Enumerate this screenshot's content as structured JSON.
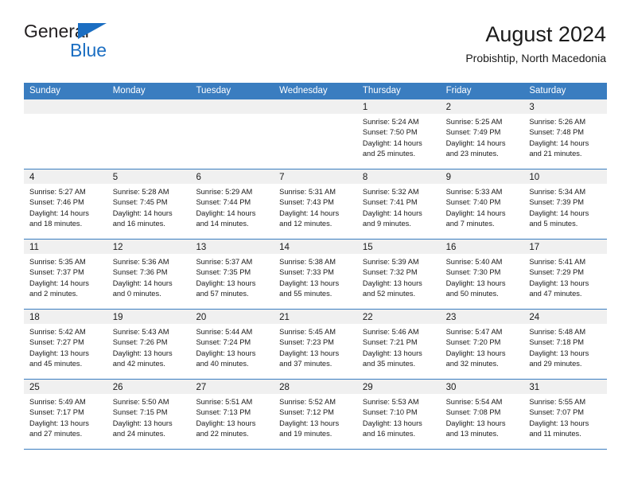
{
  "brand": {
    "name_part1": "General",
    "name_part2": "Blue",
    "triangle_color": "#1b6ec2"
  },
  "header": {
    "title": "August 2024",
    "subtitle": "Probishtip, North Macedonia"
  },
  "theme": {
    "header_bg": "#3a7dc0",
    "header_text": "#ffffff",
    "daynum_bg": "#f0f0f0",
    "grid_line": "#3a7dc0"
  },
  "weekdays": [
    "Sunday",
    "Monday",
    "Tuesday",
    "Wednesday",
    "Thursday",
    "Friday",
    "Saturday"
  ],
  "weeks": [
    [
      {
        "day": "",
        "sunrise": "",
        "sunset": "",
        "daylight1": "",
        "daylight2": ""
      },
      {
        "day": "",
        "sunrise": "",
        "sunset": "",
        "daylight1": "",
        "daylight2": ""
      },
      {
        "day": "",
        "sunrise": "",
        "sunset": "",
        "daylight1": "",
        "daylight2": ""
      },
      {
        "day": "",
        "sunrise": "",
        "sunset": "",
        "daylight1": "",
        "daylight2": ""
      },
      {
        "day": "1",
        "sunrise": "Sunrise: 5:24 AM",
        "sunset": "Sunset: 7:50 PM",
        "daylight1": "Daylight: 14 hours",
        "daylight2": "and 25 minutes."
      },
      {
        "day": "2",
        "sunrise": "Sunrise: 5:25 AM",
        "sunset": "Sunset: 7:49 PM",
        "daylight1": "Daylight: 14 hours",
        "daylight2": "and 23 minutes."
      },
      {
        "day": "3",
        "sunrise": "Sunrise: 5:26 AM",
        "sunset": "Sunset: 7:48 PM",
        "daylight1": "Daylight: 14 hours",
        "daylight2": "and 21 minutes."
      }
    ],
    [
      {
        "day": "4",
        "sunrise": "Sunrise: 5:27 AM",
        "sunset": "Sunset: 7:46 PM",
        "daylight1": "Daylight: 14 hours",
        "daylight2": "and 18 minutes."
      },
      {
        "day": "5",
        "sunrise": "Sunrise: 5:28 AM",
        "sunset": "Sunset: 7:45 PM",
        "daylight1": "Daylight: 14 hours",
        "daylight2": "and 16 minutes."
      },
      {
        "day": "6",
        "sunrise": "Sunrise: 5:29 AM",
        "sunset": "Sunset: 7:44 PM",
        "daylight1": "Daylight: 14 hours",
        "daylight2": "and 14 minutes."
      },
      {
        "day": "7",
        "sunrise": "Sunrise: 5:31 AM",
        "sunset": "Sunset: 7:43 PM",
        "daylight1": "Daylight: 14 hours",
        "daylight2": "and 12 minutes."
      },
      {
        "day": "8",
        "sunrise": "Sunrise: 5:32 AM",
        "sunset": "Sunset: 7:41 PM",
        "daylight1": "Daylight: 14 hours",
        "daylight2": "and 9 minutes."
      },
      {
        "day": "9",
        "sunrise": "Sunrise: 5:33 AM",
        "sunset": "Sunset: 7:40 PM",
        "daylight1": "Daylight: 14 hours",
        "daylight2": "and 7 minutes."
      },
      {
        "day": "10",
        "sunrise": "Sunrise: 5:34 AM",
        "sunset": "Sunset: 7:39 PM",
        "daylight1": "Daylight: 14 hours",
        "daylight2": "and 5 minutes."
      }
    ],
    [
      {
        "day": "11",
        "sunrise": "Sunrise: 5:35 AM",
        "sunset": "Sunset: 7:37 PM",
        "daylight1": "Daylight: 14 hours",
        "daylight2": "and 2 minutes."
      },
      {
        "day": "12",
        "sunrise": "Sunrise: 5:36 AM",
        "sunset": "Sunset: 7:36 PM",
        "daylight1": "Daylight: 14 hours",
        "daylight2": "and 0 minutes."
      },
      {
        "day": "13",
        "sunrise": "Sunrise: 5:37 AM",
        "sunset": "Sunset: 7:35 PM",
        "daylight1": "Daylight: 13 hours",
        "daylight2": "and 57 minutes."
      },
      {
        "day": "14",
        "sunrise": "Sunrise: 5:38 AM",
        "sunset": "Sunset: 7:33 PM",
        "daylight1": "Daylight: 13 hours",
        "daylight2": "and 55 minutes."
      },
      {
        "day": "15",
        "sunrise": "Sunrise: 5:39 AM",
        "sunset": "Sunset: 7:32 PM",
        "daylight1": "Daylight: 13 hours",
        "daylight2": "and 52 minutes."
      },
      {
        "day": "16",
        "sunrise": "Sunrise: 5:40 AM",
        "sunset": "Sunset: 7:30 PM",
        "daylight1": "Daylight: 13 hours",
        "daylight2": "and 50 minutes."
      },
      {
        "day": "17",
        "sunrise": "Sunrise: 5:41 AM",
        "sunset": "Sunset: 7:29 PM",
        "daylight1": "Daylight: 13 hours",
        "daylight2": "and 47 minutes."
      }
    ],
    [
      {
        "day": "18",
        "sunrise": "Sunrise: 5:42 AM",
        "sunset": "Sunset: 7:27 PM",
        "daylight1": "Daylight: 13 hours",
        "daylight2": "and 45 minutes."
      },
      {
        "day": "19",
        "sunrise": "Sunrise: 5:43 AM",
        "sunset": "Sunset: 7:26 PM",
        "daylight1": "Daylight: 13 hours",
        "daylight2": "and 42 minutes."
      },
      {
        "day": "20",
        "sunrise": "Sunrise: 5:44 AM",
        "sunset": "Sunset: 7:24 PM",
        "daylight1": "Daylight: 13 hours",
        "daylight2": "and 40 minutes."
      },
      {
        "day": "21",
        "sunrise": "Sunrise: 5:45 AM",
        "sunset": "Sunset: 7:23 PM",
        "daylight1": "Daylight: 13 hours",
        "daylight2": "and 37 minutes."
      },
      {
        "day": "22",
        "sunrise": "Sunrise: 5:46 AM",
        "sunset": "Sunset: 7:21 PM",
        "daylight1": "Daylight: 13 hours",
        "daylight2": "and 35 minutes."
      },
      {
        "day": "23",
        "sunrise": "Sunrise: 5:47 AM",
        "sunset": "Sunset: 7:20 PM",
        "daylight1": "Daylight: 13 hours",
        "daylight2": "and 32 minutes."
      },
      {
        "day": "24",
        "sunrise": "Sunrise: 5:48 AM",
        "sunset": "Sunset: 7:18 PM",
        "daylight1": "Daylight: 13 hours",
        "daylight2": "and 29 minutes."
      }
    ],
    [
      {
        "day": "25",
        "sunrise": "Sunrise: 5:49 AM",
        "sunset": "Sunset: 7:17 PM",
        "daylight1": "Daylight: 13 hours",
        "daylight2": "and 27 minutes."
      },
      {
        "day": "26",
        "sunrise": "Sunrise: 5:50 AM",
        "sunset": "Sunset: 7:15 PM",
        "daylight1": "Daylight: 13 hours",
        "daylight2": "and 24 minutes."
      },
      {
        "day": "27",
        "sunrise": "Sunrise: 5:51 AM",
        "sunset": "Sunset: 7:13 PM",
        "daylight1": "Daylight: 13 hours",
        "daylight2": "and 22 minutes."
      },
      {
        "day": "28",
        "sunrise": "Sunrise: 5:52 AM",
        "sunset": "Sunset: 7:12 PM",
        "daylight1": "Daylight: 13 hours",
        "daylight2": "and 19 minutes."
      },
      {
        "day": "29",
        "sunrise": "Sunrise: 5:53 AM",
        "sunset": "Sunset: 7:10 PM",
        "daylight1": "Daylight: 13 hours",
        "daylight2": "and 16 minutes."
      },
      {
        "day": "30",
        "sunrise": "Sunrise: 5:54 AM",
        "sunset": "Sunset: 7:08 PM",
        "daylight1": "Daylight: 13 hours",
        "daylight2": "and 13 minutes."
      },
      {
        "day": "31",
        "sunrise": "Sunrise: 5:55 AM",
        "sunset": "Sunset: 7:07 PM",
        "daylight1": "Daylight: 13 hours",
        "daylight2": "and 11 minutes."
      }
    ]
  ]
}
